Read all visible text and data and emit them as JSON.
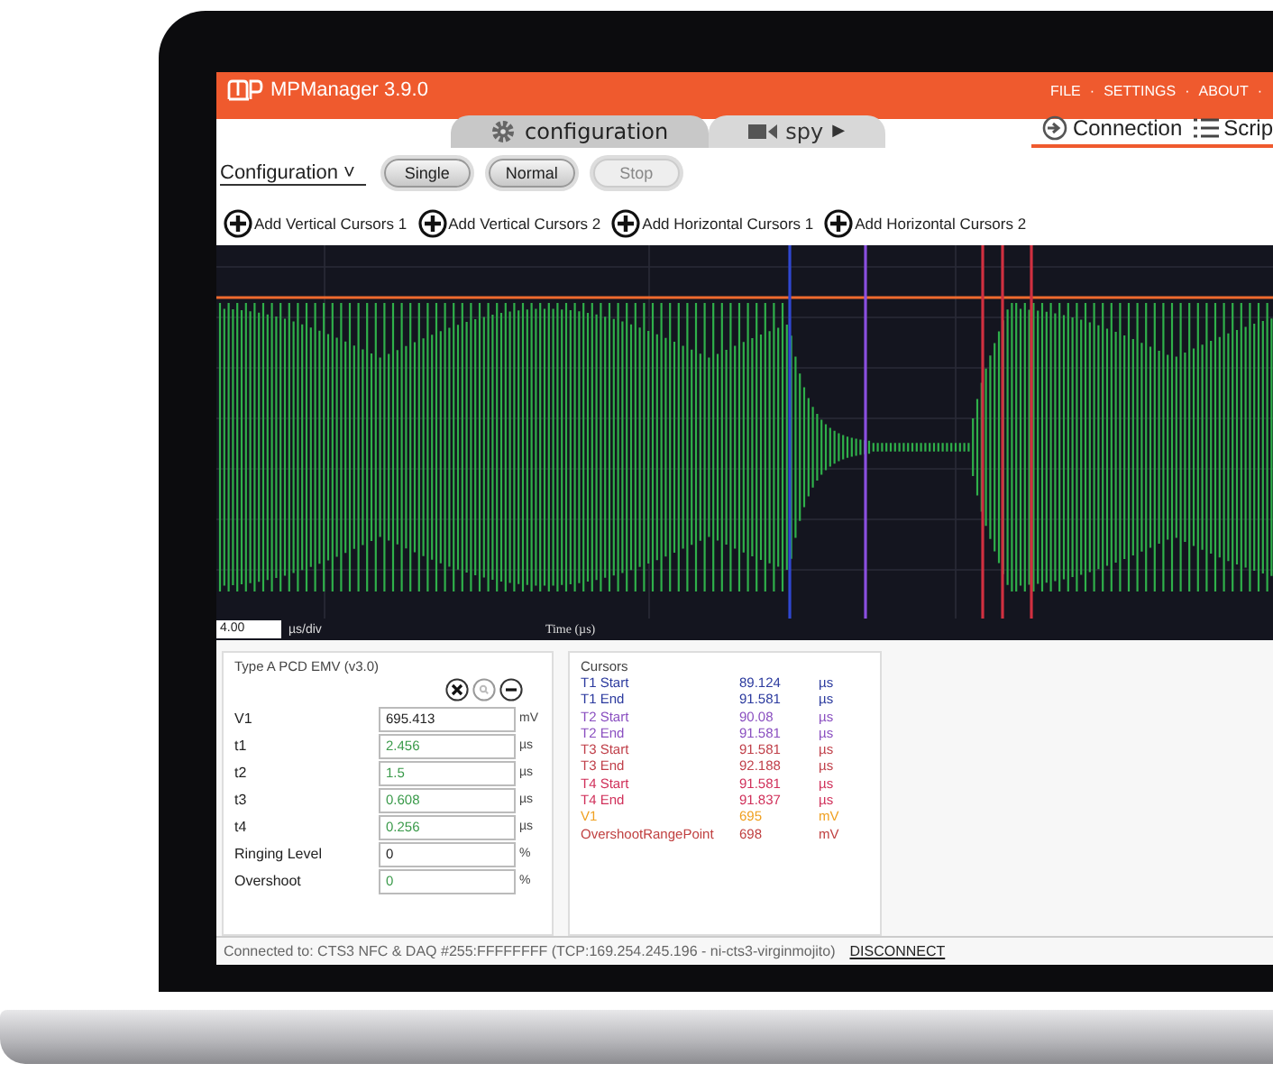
{
  "app": {
    "title": "MPManager 3.9.0",
    "menu": [
      "FILE",
      "SETTINGS",
      "ABOUT"
    ],
    "menu_separator": "·"
  },
  "tabs": [
    {
      "label": "configuration",
      "selected": true
    },
    {
      "label": "spy",
      "suffix": "▶",
      "selected": false
    }
  ],
  "side_tabs": [
    {
      "label": "Connection"
    },
    {
      "label": "Scrip"
    }
  ],
  "toolbar": {
    "dropdown": "Configuration",
    "dropdown_glyph": "˅",
    "buttons": [
      {
        "label": "Single",
        "disabled": false
      },
      {
        "label": "Normal",
        "disabled": false
      },
      {
        "label": "Stop",
        "disabled": true
      }
    ]
  },
  "cursor_actions": [
    "Add Vertical Cursors 1",
    "Add Vertical Cursors 2",
    "Add Horizontal Cursors 1",
    "Add Horizontal Cursors 2"
  ],
  "scope": {
    "timebase": "4.00",
    "timebase_unit": "µs/div",
    "xlabel": "Time (µs)"
  },
  "measurement": {
    "title": "Type A PCD EMV (v3.0)",
    "rows": [
      {
        "label": "V1",
        "value": "695.413",
        "unit": "mV",
        "color": "#222222"
      },
      {
        "label": "t1",
        "value": "2.456",
        "unit": "µs",
        "color": "#3a9a4a"
      },
      {
        "label": "t2",
        "value": "1.5",
        "unit": "µs",
        "color": "#3a9a4a"
      },
      {
        "label": "t3",
        "value": "0.608",
        "unit": "µs",
        "color": "#3a9a4a"
      },
      {
        "label": "t4",
        "value": "0.256",
        "unit": "µs",
        "color": "#3a9a4a"
      },
      {
        "label": "Ringing Level",
        "value": "0",
        "unit": "%",
        "color": "#222222"
      },
      {
        "label": "Overshoot",
        "value": "0",
        "unit": "%",
        "color": "#3a9a4a"
      }
    ]
  },
  "cursors": {
    "title": "Cursors",
    "items": [
      {
        "name": "T1 Start",
        "value": "89.124",
        "unit": "µs",
        "color": "#2b3a9e"
      },
      {
        "name": "T1 End",
        "value": "91.581",
        "unit": "µs",
        "color": "#2b3a9e"
      },
      {
        "name": "T2 Start",
        "value": "90.08",
        "unit": "µs",
        "color": "#8a4fc0"
      },
      {
        "name": "T2 End",
        "value": "91.581",
        "unit": "µs",
        "color": "#8a4fc0"
      },
      {
        "name": "T3 Start",
        "value": "91.581",
        "unit": "µs",
        "color": "#c0404a"
      },
      {
        "name": "T3 End",
        "value": "92.188",
        "unit": "µs",
        "color": "#c0404a"
      },
      {
        "name": "T4 Start",
        "value": "91.581",
        "unit": "µs",
        "color": "#d0305a"
      },
      {
        "name": "T4 End",
        "value": "91.837",
        "unit": "µs",
        "color": "#d0305a"
      },
      {
        "name": "V1",
        "value": "695",
        "unit": "mV",
        "color": "#f0a020"
      },
      {
        "name": "OvershootRangePoint",
        "value": "698",
        "unit": "mV",
        "color": "#c04040"
      }
    ]
  },
  "status": {
    "text": "Connected to: CTS3 NFC & DAQ #255:FFFFFFFF (TCP:169.254.245.196 - ni-cts3-virginmojito)",
    "link": "DISCONNECT"
  }
}
